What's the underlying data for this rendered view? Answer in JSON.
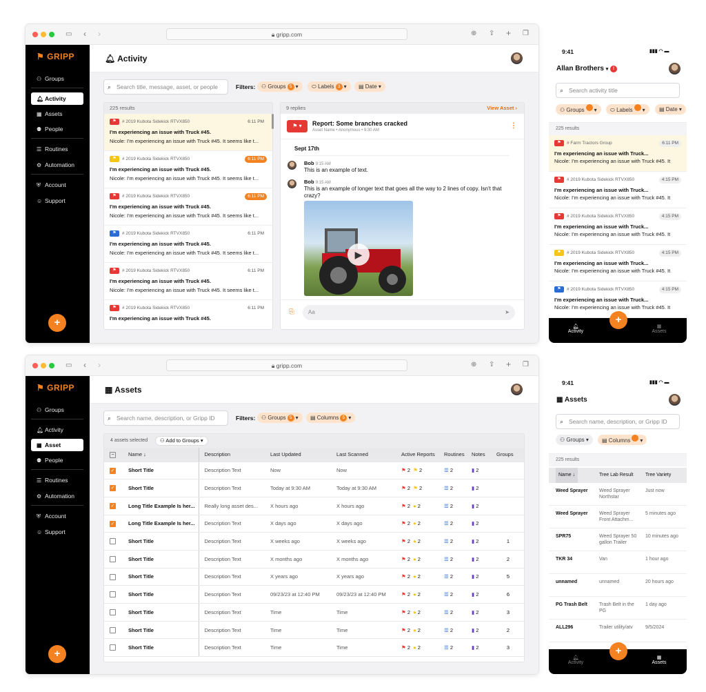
{
  "browser": {
    "url": "gripp.com"
  },
  "brand": {
    "name": "GRIPP",
    "accent": "#f58220"
  },
  "nav": {
    "groups": "Groups",
    "activity": "Activity",
    "assets": "Assets",
    "asset": "Asset",
    "people": "People",
    "routines": "Routines",
    "automation": "Automation",
    "account": "Account",
    "support": "Support"
  },
  "fab": "+",
  "activity": {
    "title": "Activity",
    "search_placeholder": "Search title, message, asset, or people",
    "filters_label": "Filters:",
    "chips": {
      "groups": "Groups",
      "groups_count": "5",
      "labels": "Labels",
      "labels_count": "3",
      "date": "Date"
    },
    "results": "225 results",
    "items": [
      {
        "tag": "# 2019 Kubota Sidekick RTVX850",
        "time": "6:11 PM",
        "title": "I'm experiencing an issue with Truck #45.",
        "msg": "Nicole: I'm experiencing an issue with Truck #45. It seems like t..."
      },
      {
        "tag": "# 2019 Kubota Sidekick RTVX850",
        "time": "6:11 PM",
        "title": "I'm experiencing an issue with Truck #45.",
        "msg": "Nicole: I'm experiencing an issue with Truck #45. It seems like t..."
      },
      {
        "tag": "# 2019 Kubota Sidekick RTVX850",
        "time": "6:11 PM",
        "title": "I'm experiencing an issue with Truck #45.",
        "msg": "Nicole: I'm experiencing an issue with Truck #45. It seems like t..."
      },
      {
        "tag": "# 2019 Kubota Sidekick RTVX850",
        "time": "6:11 PM",
        "title": "I'm experiencing an issue with Truck #45.",
        "msg": "Nicole: I'm experiencing an issue with Truck #45. It seems like t..."
      },
      {
        "tag": "# 2019 Kubota Sidekick RTVX850",
        "time": "6:11 PM",
        "title": "I'm experiencing an issue with Truck #45.",
        "msg": "Nicole: I'm experiencing an issue with Truck #45. It seems like t..."
      },
      {
        "tag": "# 2019 Kubota Sidekick RTVX850",
        "time": "6:11 PM",
        "title": "I'm experiencing an issue with Truck #45.",
        "msg": ""
      }
    ],
    "thread": {
      "replies": "9 replies",
      "view_asset": "View Asset",
      "report_title": "Report: Some branches cracked",
      "report_sub": "Asset Name • Anonymous • 9:30 AM",
      "date": "Sept 17th",
      "messages": [
        {
          "name": "Bob",
          "time": "9:15 AM",
          "text": "This is an example of text."
        },
        {
          "name": "Bob",
          "time": "9:15 AM",
          "text": "This is an example of longer text that goes all the way to 2 lines of copy. Isn't that crazy?"
        }
      ],
      "input_placeholder": "Aa"
    }
  },
  "assets": {
    "title": "Assets",
    "search_placeholder": "Search name, description, or Gripp ID",
    "filters_label": "Filters:",
    "chips": {
      "groups": "Groups",
      "groups_count": "5",
      "columns": "Columns",
      "columns_count": "5"
    },
    "selected": "4 assets selected",
    "add_to_groups": "Add to Groups",
    "columns": [
      "Name",
      "Description",
      "Last Updated",
      "Last Scanned",
      "Active Reports",
      "Routines",
      "Notes",
      "Groups"
    ],
    "rows": [
      {
        "checked": true,
        "name": "Short Title",
        "desc": "Description Text",
        "updated": "Now",
        "scanned": "Now",
        "r1": "2",
        "r2": "2",
        "routines": "2",
        "notes": "2",
        "groups": ""
      },
      {
        "checked": true,
        "name": "Short Title",
        "desc": "Description Text",
        "updated": "Today at 9:30 AM",
        "scanned": "Today at 9:30 AM",
        "r1": "2",
        "r2": "2",
        "routines": "2",
        "notes": "2",
        "groups": ""
      },
      {
        "checked": true,
        "name": "Long Title Example Is her...",
        "desc": "Really long asset des...",
        "updated": "X hours ago",
        "scanned": "X hours ago",
        "r1": "2",
        "r2": "2",
        "routines": "2",
        "notes": "2",
        "groups": ""
      },
      {
        "checked": true,
        "name": "Long Title Example Is her...",
        "desc": "Description Text",
        "updated": "X days ago",
        "scanned": "X days ago",
        "r1": "2",
        "r2": "2",
        "routines": "2",
        "notes": "2",
        "groups": ""
      },
      {
        "checked": false,
        "name": "Short Title",
        "desc": "Description Text",
        "updated": "X weeks ago",
        "scanned": "X weeks ago",
        "r1": "2",
        "r2": "2",
        "routines": "2",
        "notes": "2",
        "groups": "1"
      },
      {
        "checked": false,
        "name": "Short Title",
        "desc": "Description Text",
        "updated": "X months ago",
        "scanned": "X months ago",
        "r1": "2",
        "r2": "2",
        "routines": "2",
        "notes": "2",
        "groups": "2"
      },
      {
        "checked": false,
        "name": "Short Title",
        "desc": "Description Text",
        "updated": "X years ago",
        "scanned": "X years ago",
        "r1": "2",
        "r2": "2",
        "routines": "2",
        "notes": "2",
        "groups": "5"
      },
      {
        "checked": false,
        "name": "Short Title",
        "desc": "Description Text",
        "updated": "09/23/23 at 12:40 PM",
        "scanned": "09/23/23 at 12:40 PM",
        "r1": "2",
        "r2": "2",
        "routines": "2",
        "notes": "2",
        "groups": "6"
      },
      {
        "checked": false,
        "name": "Short Title",
        "desc": "Description Text",
        "updated": "Time",
        "scanned": "Time",
        "r1": "2",
        "r2": "2",
        "routines": "2",
        "notes": "2",
        "groups": "3"
      },
      {
        "checked": false,
        "name": "Short Title",
        "desc": "Description Text",
        "updated": "Time",
        "scanned": "Time",
        "r1": "2",
        "r2": "2",
        "routines": "2",
        "notes": "2",
        "groups": "2"
      },
      {
        "checked": false,
        "name": "Short Title",
        "desc": "Description Text",
        "updated": "Time",
        "scanned": "Time",
        "r1": "2",
        "r2": "2",
        "routines": "2",
        "notes": "2",
        "groups": "3"
      }
    ]
  },
  "mobile_activity": {
    "clock": "9:41",
    "org": "Allan Brothers",
    "search_placeholder": "Search activity title",
    "chips": {
      "groups": "Groups",
      "labels": "Labels",
      "date": "Date"
    },
    "results": "225 results",
    "items": [
      {
        "tag": "# Farm Tractors Group",
        "time": "6:11 PM",
        "title": "I'm experiencing an issue with Truck...",
        "msg": "Nicole: I'm experiencing an issue with Truck #45. It"
      },
      {
        "tag": "# 2019 Kubota Sidekick RTVX850",
        "time": "4:15 PM",
        "title": "I'm experiencing an issue with Truck...",
        "msg": "Nicole: I'm experiencing an issue with Truck #45. It"
      },
      {
        "tag": "# 2019 Kubota Sidekick RTVX850",
        "time": "4:15 PM",
        "title": "I'm experiencing an issue with Truck...",
        "msg": "Nicole: I'm experiencing an issue with Truck #45. It"
      },
      {
        "tag": "# 2019 Kubota Sidekick RTVX850",
        "time": "4:15 PM",
        "title": "I'm experiencing an issue with Truck...",
        "msg": "Nicole: I'm experiencing an issue with Truck #45. It"
      },
      {
        "tag": "# 2019 Kubota Sidekick RTVX850",
        "time": "4:15 PM",
        "title": "I'm experiencing an issue with Truck...",
        "msg": "Nicole: I'm experiencing an issue with Truck #45. It"
      }
    ],
    "tabs": {
      "activity": "Activity",
      "assets": "Assets"
    }
  },
  "mobile_assets": {
    "clock": "9:41",
    "title": "Assets",
    "search_placeholder": "Search name, description, or Gripp ID",
    "chips": {
      "groups": "Groups",
      "columns": "Columns"
    },
    "results": "225 results",
    "columns": [
      "Name",
      "Tree Lab Result",
      "Tree Variety"
    ],
    "rows": [
      {
        "name": "Weed Sprayer",
        "lab": "Weed Sprayer Northstar",
        "variety": "Just now"
      },
      {
        "name": "Weed Sprayer",
        "lab": "Weed Sprayer Front Attachm...",
        "variety": "5 minutes ago"
      },
      {
        "name": "SPR75",
        "lab": "Weed Sprayer 50 gallon Trailer",
        "variety": "10 minutes ago"
      },
      {
        "name": "TKR 34",
        "lab": "Van",
        "variety": "1 hour ago"
      },
      {
        "name": "unnamed",
        "lab": "unnamed",
        "variety": "20 hours ago"
      },
      {
        "name": "PG Trash Belt",
        "lab": "Trash Belt in the PG",
        "variety": "1 day ago"
      },
      {
        "name": "ALL296",
        "lab": "Trailer utility/atv",
        "variety": "9/5/2024"
      }
    ],
    "tabs": {
      "activity": "Activity",
      "assets": "Assets"
    }
  }
}
